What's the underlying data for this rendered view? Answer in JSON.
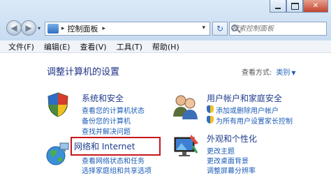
{
  "toolbar": {
    "address_path": "控制面板",
    "search_placeholder": "搜索控制面板"
  },
  "menu": [
    "文件(F)",
    "编辑(E)",
    "查看(V)",
    "工具(T)",
    "帮助(H)"
  ],
  "page": {
    "title": "调整计算机的设置",
    "view_by_label": "查看方式:",
    "view_by_value": "类别"
  },
  "categories": {
    "system": {
      "title": "系统和安全",
      "links": [
        "查看您的计算机状态",
        "备份您的计算机",
        "查找并解决问题"
      ]
    },
    "network": {
      "title": "网络和 Internet",
      "links": [
        "查看网络状态和任务",
        "选择家庭组和共享选项"
      ]
    },
    "users": {
      "title": "用户帐户和家庭安全",
      "links": [
        "添加或删除用户帐户",
        "为所有用户设置家长控制"
      ]
    },
    "appearance": {
      "title": "外观和个性化",
      "links": [
        "更改主题",
        "更改桌面背景",
        "调整屏幕分辨率"
      ]
    }
  },
  "colors": {
    "highlight_box": "#c4171c",
    "link": "#1d5db7",
    "title": "#1e3287"
  }
}
